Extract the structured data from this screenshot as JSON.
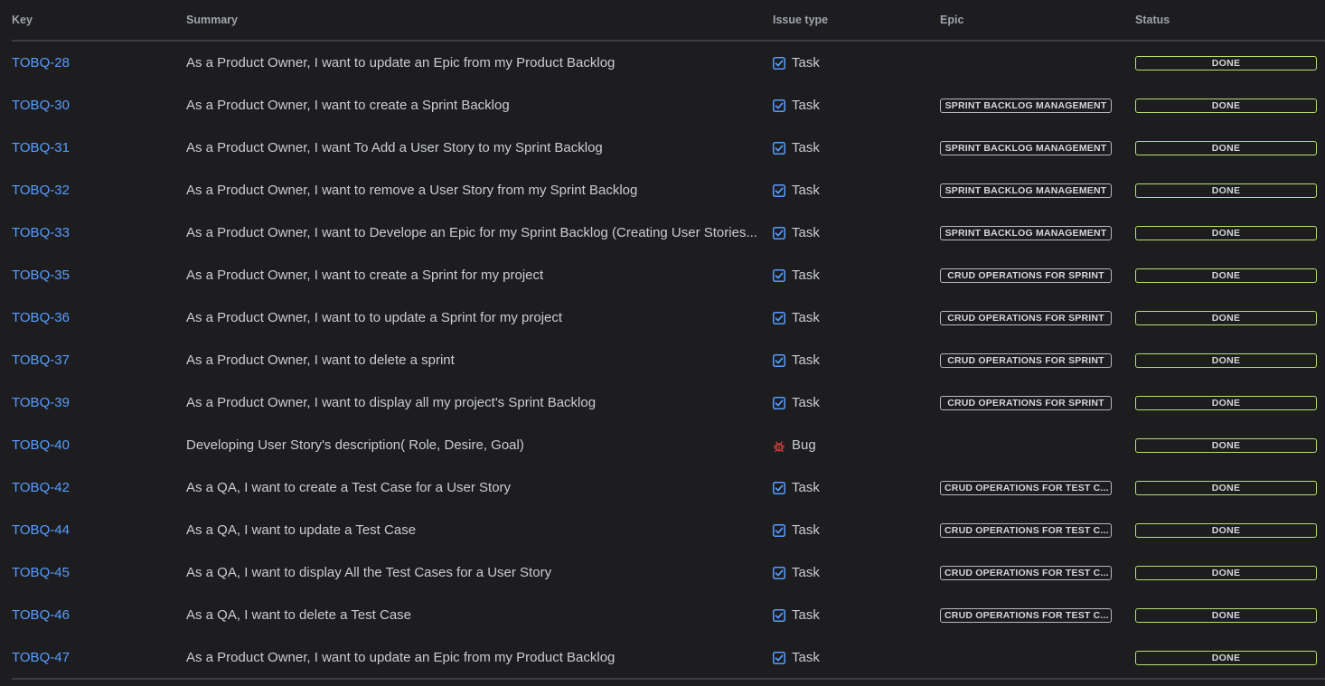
{
  "columns": {
    "key": "Key",
    "summary": "Summary",
    "issue_type": "Issue type",
    "epic": "Epic",
    "status": "Status"
  },
  "colors": {
    "background": "#1d1d20",
    "link": "#579dff",
    "task_icon": "#579dff",
    "bug_icon": "#e2483d",
    "done_border": "#b3df72"
  },
  "rows": [
    {
      "key": "TOBQ-28",
      "summary": "As a Product Owner, I want to update an Epic from my Product Backlog",
      "type": "Task",
      "type_icon": "checkbox-icon",
      "epic": "",
      "status": "DONE"
    },
    {
      "key": "TOBQ-30",
      "summary": "As a Product Owner, I want to create a Sprint Backlog",
      "type": "Task",
      "type_icon": "checkbox-icon",
      "epic": "SPRINT BACKLOG MANAGEMENT",
      "status": "DONE"
    },
    {
      "key": "TOBQ-31",
      "summary": "As a Product Owner, I want To Add a User Story to my Sprint Backlog",
      "type": "Task",
      "type_icon": "checkbox-icon",
      "epic": "SPRINT BACKLOG MANAGEMENT",
      "status": "DONE"
    },
    {
      "key": "TOBQ-32",
      "summary": "As a Product Owner, I want to remove a User Story from my Sprint Backlog",
      "type": "Task",
      "type_icon": "checkbox-icon",
      "epic": "SPRINT BACKLOG MANAGEMENT",
      "status": "DONE"
    },
    {
      "key": "TOBQ-33",
      "summary": "As a Product Owner, I want to Develope an Epic for my Sprint Backlog (Creating User Stories...",
      "type": "Task",
      "type_icon": "checkbox-icon",
      "epic": "SPRINT BACKLOG MANAGEMENT",
      "status": "DONE"
    },
    {
      "key": "TOBQ-35",
      "summary": "As a Product Owner, I want to create a Sprint for my project",
      "type": "Task",
      "type_icon": "checkbox-icon",
      "epic": "CRUD OPERATIONS FOR SPRINT",
      "status": "DONE"
    },
    {
      "key": "TOBQ-36",
      "summary": "As a Product Owner, I want to to update a Sprint for my project",
      "type": "Task",
      "type_icon": "checkbox-icon",
      "epic": "CRUD OPERATIONS FOR SPRINT",
      "status": "DONE"
    },
    {
      "key": "TOBQ-37",
      "summary": "As a Product Owner, I want to delete a sprint",
      "type": "Task",
      "type_icon": "checkbox-icon",
      "epic": "CRUD OPERATIONS FOR SPRINT",
      "status": "DONE"
    },
    {
      "key": "TOBQ-39",
      "summary": "As a Product Owner, I want to display all my project's Sprint Backlog",
      "type": "Task",
      "type_icon": "checkbox-icon",
      "epic": "CRUD OPERATIONS FOR SPRINT",
      "status": "DONE"
    },
    {
      "key": "TOBQ-40",
      "summary": "Developing User Story's description( Role, Desire, Goal)",
      "type": "Bug",
      "type_icon": "bug-icon",
      "epic": "",
      "status": "DONE"
    },
    {
      "key": "TOBQ-42",
      "summary": "As a QA, I want to create a Test Case for a User Story",
      "type": "Task",
      "type_icon": "checkbox-icon",
      "epic": "CRUD OPERATIONS FOR TEST C...",
      "status": "DONE"
    },
    {
      "key": "TOBQ-44",
      "summary": "As a QA, I want to update a Test Case",
      "type": "Task",
      "type_icon": "checkbox-icon",
      "epic": "CRUD OPERATIONS FOR TEST C...",
      "status": "DONE"
    },
    {
      "key": "TOBQ-45",
      "summary": "As a QA, I want to display All the Test Cases for a User Story",
      "type": "Task",
      "type_icon": "checkbox-icon",
      "epic": "CRUD OPERATIONS FOR TEST C...",
      "status": "DONE"
    },
    {
      "key": "TOBQ-46",
      "summary": "As a QA, I want to delete a Test Case",
      "type": "Task",
      "type_icon": "checkbox-icon",
      "epic": "CRUD OPERATIONS FOR TEST C...",
      "status": "DONE"
    },
    {
      "key": "TOBQ-47",
      "summary": "As a Product Owner, I want to update an Epic from my Product Backlog",
      "type": "Task",
      "type_icon": "checkbox-icon",
      "epic": "",
      "status": "DONE"
    }
  ]
}
